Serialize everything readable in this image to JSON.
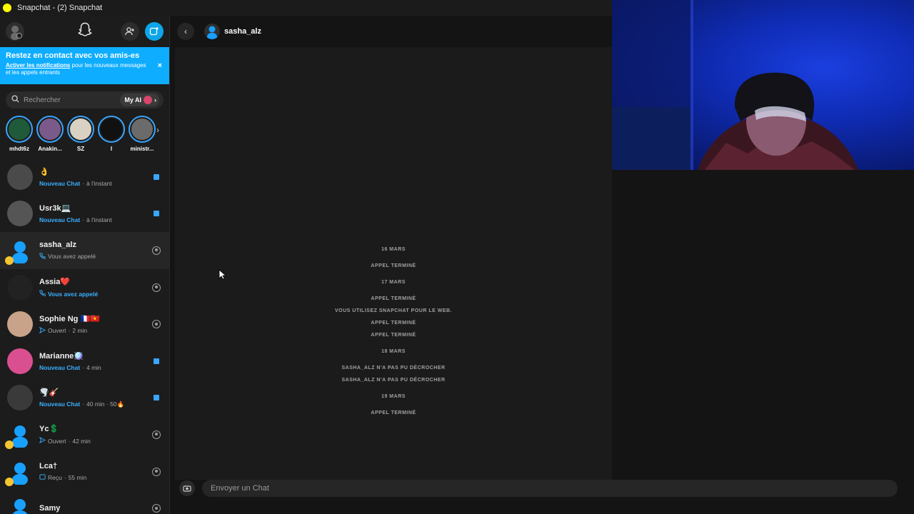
{
  "window": {
    "title": "Snapchat - (2) Snapchat"
  },
  "sidebar": {
    "banner": {
      "title": "Restez en contact avec vos amis-es",
      "link": "Activer les notifications",
      "text": " pour les nouveaux messages et les appels entrants",
      "close": "×"
    },
    "search": {
      "placeholder": "Rechercher",
      "myai_label": "My AI"
    },
    "stories": [
      {
        "name": "mhdt6z",
        "color": "#1f5a3a"
      },
      {
        "name": "Anakin...",
        "color": "#7a5a8a"
      },
      {
        "name": "SZ",
        "color": "#d9d2c4"
      },
      {
        "name": "I",
        "color": "#111111"
      },
      {
        "name": "ministr...",
        "color": "#6b6b6b"
      }
    ],
    "chats": [
      {
        "name": "👌",
        "status": "Nouveau Chat",
        "time": "à l'instant",
        "status_type": "new",
        "indicator": "square",
        "avatar": "#4a4a4a"
      },
      {
        "name": "Usr3k💻",
        "status": "Nouveau Chat",
        "time": "à l'instant",
        "status_type": "new",
        "indicator": "square",
        "avatar": "#555555"
      },
      {
        "name": "sasha_alz",
        "status": "Vous avez appelé",
        "time": "",
        "status_type": "called",
        "indicator": "camera",
        "avatar": "#18a0ff"
      },
      {
        "name": "Assia❤️",
        "status": "Vous avez appelé",
        "time": "",
        "status_type": "called-blue",
        "indicator": "camera",
        "avatar": "#222222"
      },
      {
        "name": "Sophie Ng 🇫🇷🇻🇳",
        "status": "Ouvert",
        "time": "2 min",
        "status_type": "opened",
        "indicator": "camera",
        "avatar": "#c8a38a"
      },
      {
        "name": "Marianne🪩",
        "status": "Nouveau Chat",
        "time": "4 min",
        "status_type": "new",
        "indicator": "square",
        "avatar": "#d94f8f"
      },
      {
        "name": "🌪️🎸",
        "status": "Nouveau Chat",
        "time": "40 min · 50🔥",
        "status_type": "new",
        "indicator": "square",
        "avatar": "#3a3a3a"
      },
      {
        "name": "Yc💲",
        "status": "Ouvert",
        "time": "42 min",
        "status_type": "opened",
        "indicator": "camera",
        "avatar": "#18a0ff"
      },
      {
        "name": "Lca†",
        "status": "Reçu",
        "time": "55 min",
        "status_type": "received",
        "indicator": "camera",
        "avatar": "#18a0ff"
      },
      {
        "name": "Samy",
        "status": "",
        "time": "",
        "status_type": "none",
        "indicator": "camera",
        "avatar": "#18a0ff"
      }
    ]
  },
  "conversation": {
    "contact_name": "sasha_alz",
    "events": [
      "16 MARS",
      "APPEL TERMINÉ",
      "17 MARS",
      "APPEL TERMINÉ",
      "VOUS UTILISEZ SNAPCHAT POUR LE WEB.",
      "APPEL TERMINÉ",
      "APPEL TERMINÉ",
      "18 MARS",
      "SASHA_ALZ N'A PAS PU DÉCROCHER",
      "SASHA_ALZ N'A PAS PU DÉCROCHER",
      "19 MARS",
      "APPEL TERMINÉ"
    ],
    "composer_placeholder": "Envoyer un Chat"
  }
}
